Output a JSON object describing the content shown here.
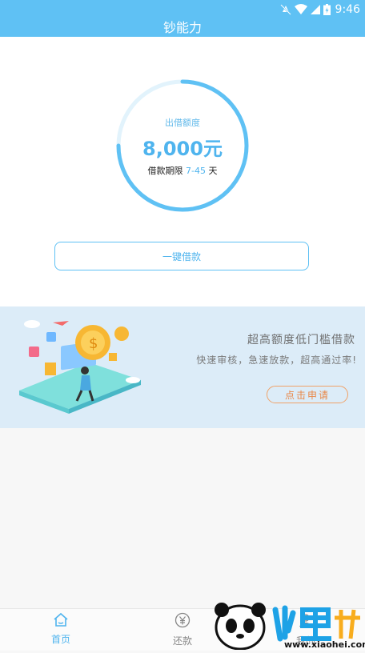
{
  "status": {
    "time": "9:46"
  },
  "app": {
    "title": "钞能力"
  },
  "quota": {
    "label": "出借额度",
    "amount": "8,000元",
    "term_prefix": "借款期限",
    "term_range": "7-45",
    "term_suffix": "天"
  },
  "action": {
    "loan_button": "一键借款"
  },
  "banner": {
    "title": "超高额度低门槛借款",
    "subtitle": "快速审核，急速放款，超高通过率!",
    "apply_button": "点击申请"
  },
  "tabs": [
    {
      "label": "首页",
      "icon": "home-icon",
      "active": true
    },
    {
      "label": "还款",
      "icon": "yen-icon",
      "active": false
    },
    {
      "label": "我的",
      "icon": "user-icon",
      "active": false
    }
  ],
  "watermark": {
    "url": "www.xiaohei.com"
  },
  "colors": {
    "primary": "#5fc1f4",
    "accent": "#f0a268",
    "banner_bg": "#dcecf8"
  }
}
